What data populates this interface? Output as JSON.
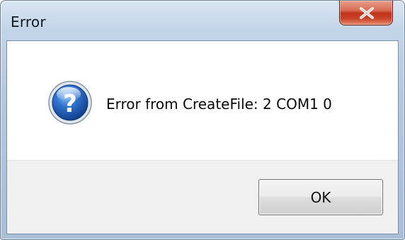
{
  "window": {
    "title": "Error",
    "close_icon": "close-icon"
  },
  "message": {
    "icon": "question-icon",
    "text": "Error from CreateFile: 2 COM1 0"
  },
  "buttons": {
    "ok_label": "OK"
  },
  "colors": {
    "close_button": "#c8442a",
    "icon_blue": "#1f5fb8",
    "button_bar": "#f0f0f0"
  }
}
